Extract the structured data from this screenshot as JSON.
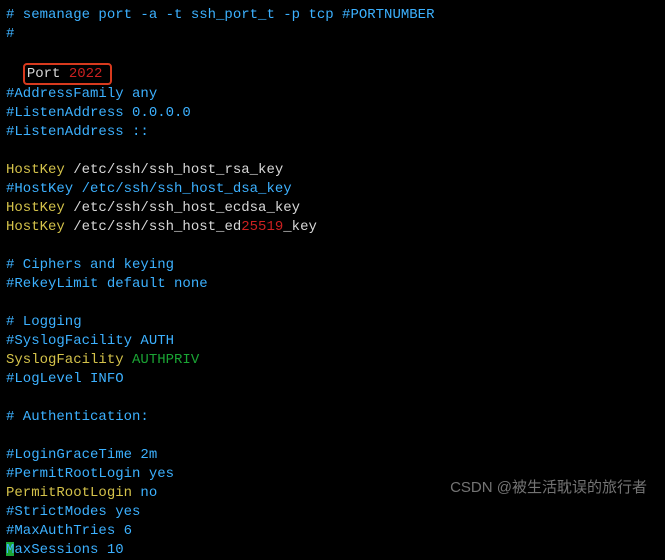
{
  "l1": "# semanage port -a -t ssh_port_t -p tcp #PORTNUMBER",
  "l2": "#",
  "port_kw": "Port ",
  "port_num": "2022",
  "l4": "#AddressFamily any",
  "l5": "#ListenAddress 0.0.0.0",
  "l6": "#ListenAddress ::",
  "hk1_a": "HostKey",
  "hk1_b": " /etc/ssh/ssh_host_rsa_key",
  "hk2": "#HostKey /etc/ssh/ssh_host_dsa_key",
  "hk3_a": "HostKey",
  "hk3_b": " /etc/ssh/ssh_host_ecdsa_key",
  "hk4_a": "HostKey",
  "hk4_b": " /etc/ssh/ssh_host_ed",
  "hk4_c": "25519",
  "hk4_d": "_key",
  "ck1": "# Ciphers and keying",
  "ck2": "#RekeyLimit default none",
  "lg1": "# Logging",
  "lg2": "#SyslogFacility AUTH",
  "sf_a": "SyslogFacility",
  "sf_b": " AUTHPRIV",
  "lg4": "#LogLevel INFO",
  "au1": "# Authentication:",
  "au2": "#LoginGraceTime 2m",
  "au3": "#PermitRootLogin yes",
  "prl_a": "PermitRootLogin",
  "prl_b": " no",
  "au5": "#StrictModes yes",
  "au6": "#MaxAuthTries 6",
  "au7": "MaxSessions 10",
  "watermark": "CSDN @被生活耽误的旅行者"
}
